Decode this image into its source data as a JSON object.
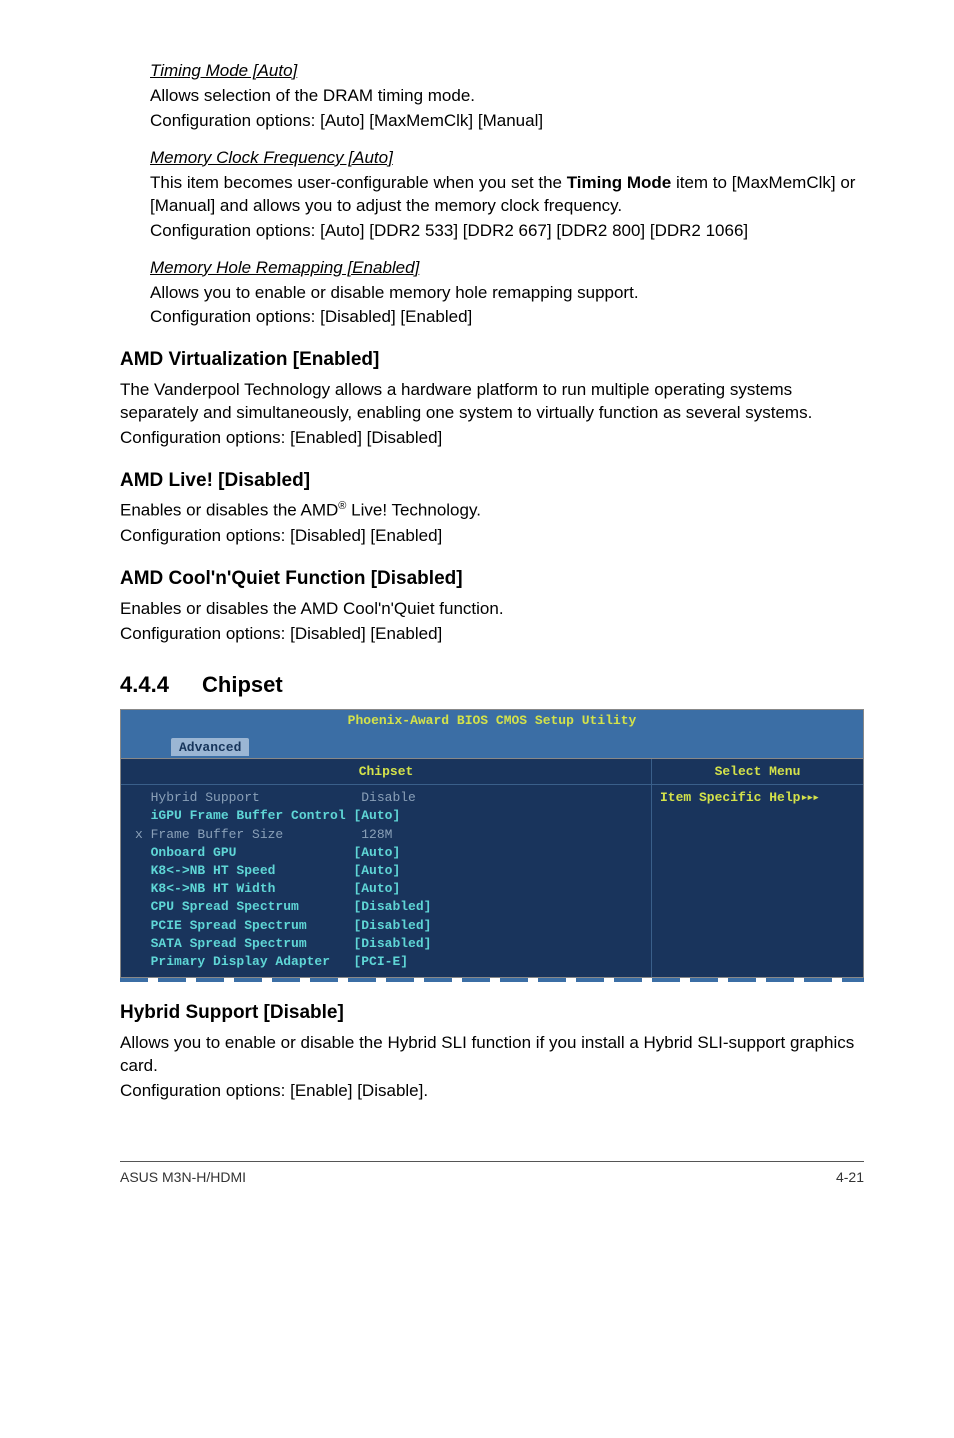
{
  "timing": {
    "title": "Timing Mode [Auto]",
    "l1": "Allows selection of the DRAM timing mode.",
    "l2": "Configuration options: [Auto] [MaxMemClk] [Manual]"
  },
  "memclock": {
    "title": "Memory Clock Frequency [Auto]",
    "l1a": "This item becomes user-configurable when you set the ",
    "l1b": "Timing Mode",
    "l1c": " item to [MaxMemClk] or [Manual] and allows you to adjust the memory clock frequency.",
    "l2": "Configuration options: [Auto] [DDR2 533] [DDR2 667] [DDR2 800] [DDR2 1066]"
  },
  "memhole": {
    "title": "Memory Hole Remapping [Enabled]",
    "l1": "Allows you to enable or disable memory hole remapping support.",
    "l2": "Configuration options: [Disabled] [Enabled]"
  },
  "amdvirt": {
    "h": "AMD Virtualization [Enabled]",
    "p1": "The Vanderpool Technology allows a hardware platform to run multiple operating systems separately and simultaneously, enabling one system to virtually function as several systems.",
    "p2": "Configuration options: [Enabled] [Disabled]"
  },
  "amdlive": {
    "h": "AMD Live! [Disabled]",
    "p1a": "Enables or disables the AMD",
    "p1b": "®",
    "p1c": " Live! Technology.",
    "p2": "Configuration options: [Disabled] [Enabled]"
  },
  "amdcool": {
    "h": "AMD Cool'n'Quiet Function [Disabled]",
    "p1": "Enables or disables the AMD Cool'n'Quiet function.",
    "p2": "Configuration options: [Disabled] [Enabled]"
  },
  "section": {
    "num": "4.4.4",
    "title": "Chipset"
  },
  "bios": {
    "title": "Phoenix-Award BIOS CMOS Setup Utility",
    "tab": "Advanced",
    "left_head": "Chipset",
    "right_head": "Select Menu",
    "help_label": "Item Specific Help",
    "rows": [
      {
        "mark": " ",
        "label": "Hybrid Support",
        "value": " Disable",
        "cls": "bios-gray"
      },
      {
        "mark": " ",
        "label": "iGPU Frame Buffer Control",
        "value": "[Auto]",
        "cls": "bios-cyan"
      },
      {
        "mark": "x",
        "label": "Frame Buffer Size",
        "value": " 128M",
        "cls": "bios-gray"
      },
      {
        "mark": " ",
        "label": "Onboard GPU",
        "value": "[Auto]",
        "cls": "bios-cyan"
      },
      {
        "mark": " ",
        "label": "K8<->NB HT Speed",
        "value": "[Auto]",
        "cls": "bios-cyan"
      },
      {
        "mark": " ",
        "label": "K8<->NB HT Width",
        "value": "[Auto]",
        "cls": "bios-cyan"
      },
      {
        "mark": " ",
        "label": "CPU Spread Spectrum",
        "value": "[Disabled]",
        "cls": "bios-cyan"
      },
      {
        "mark": " ",
        "label": "PCIE Spread Spectrum",
        "value": "[Disabled]",
        "cls": "bios-cyan"
      },
      {
        "mark": " ",
        "label": "SATA Spread Spectrum",
        "value": "[Disabled]",
        "cls": "bios-cyan"
      },
      {
        "mark": " ",
        "label": "Primary Display Adapter",
        "value": "[PCI-E]",
        "cls": "bios-cyan"
      }
    ]
  },
  "hybrid": {
    "h": "Hybrid Support [Disable]",
    "p1": "Allows you to enable or disable the Hybrid SLI function if you install a Hybrid SLI-support graphics card.",
    "p2": "Configuration options: [Enable] [Disable]."
  },
  "footer": {
    "left": "ASUS M3N-H/HDMI",
    "right": "4-21"
  }
}
